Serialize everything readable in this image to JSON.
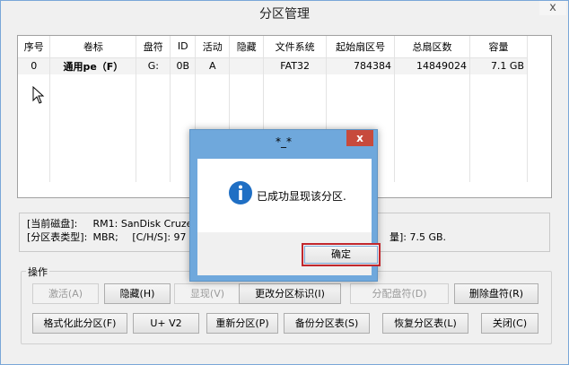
{
  "window": {
    "title": "分区管理",
    "close_glyph": "x"
  },
  "table": {
    "headers": [
      "序号",
      "卷标",
      "盘符",
      "ID",
      "活动",
      "隐藏",
      "文件系统",
      "起始扇区号",
      "总扇区数",
      "容量"
    ],
    "rows": [
      [
        "0",
        "通用pe（F）",
        "G:",
        "0B",
        "A",
        "",
        "FAT32",
        "784384",
        "14849024",
        "7.1 GB"
      ]
    ]
  },
  "info": {
    "disk_label": "[当前磁盘]:",
    "disk_value": "RM1: SanDisk Cruzer",
    "pt_label": "[分区表类型]:",
    "pt_value": "MBR;",
    "chs_value": "[C/H/S]: 97",
    "capacity_tail": "量]: 7.5 GB."
  },
  "ops": {
    "label": "操作",
    "row1": [
      "激活(A)",
      "隐藏(H)",
      "显现(V)",
      "更改分区标识(I)",
      "分配盘符(D)",
      "删除盘符(R)"
    ],
    "row2": [
      "格式化此分区(F)",
      "U+ V2",
      "重新分区(P)",
      "备份分区表(S)",
      "恢复分区表(L)",
      "关闭(C)"
    ]
  },
  "dialog": {
    "title": "*_*",
    "close_glyph": "x",
    "message": "已成功显现该分区.",
    "ok_label": "确定",
    "icon": "info-icon"
  }
}
